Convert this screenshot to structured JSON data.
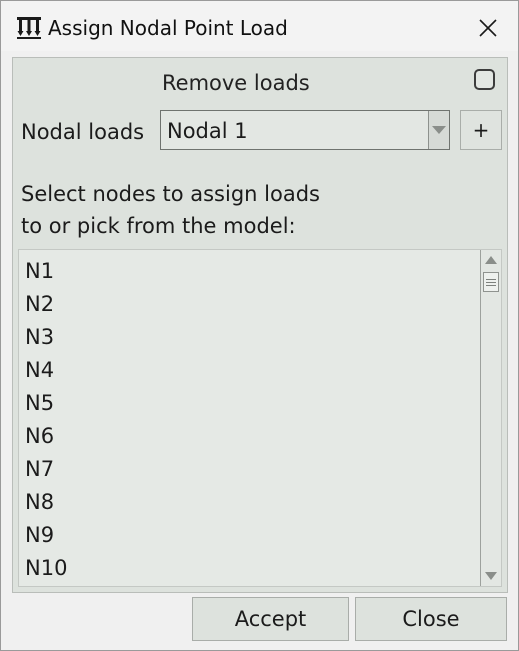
{
  "window": {
    "title": "Assign Nodal Point Load",
    "app_icon": "nodal-load-icon",
    "close_icon": "close-icon"
  },
  "remove_loads": {
    "label": "Remove loads",
    "checked": false
  },
  "nodal_loads": {
    "label": "Nodal loads",
    "selected": "Nodal 1",
    "add_label": "+"
  },
  "instructions": {
    "line1": "Select nodes to assign loads",
    "line2": "to or pick from the model:"
  },
  "nodes": [
    "N1",
    "N2",
    "N3",
    "N4",
    "N5",
    "N6",
    "N7",
    "N8",
    "N9",
    "N10"
  ],
  "buttons": {
    "accept": "Accept",
    "close": "Close"
  }
}
